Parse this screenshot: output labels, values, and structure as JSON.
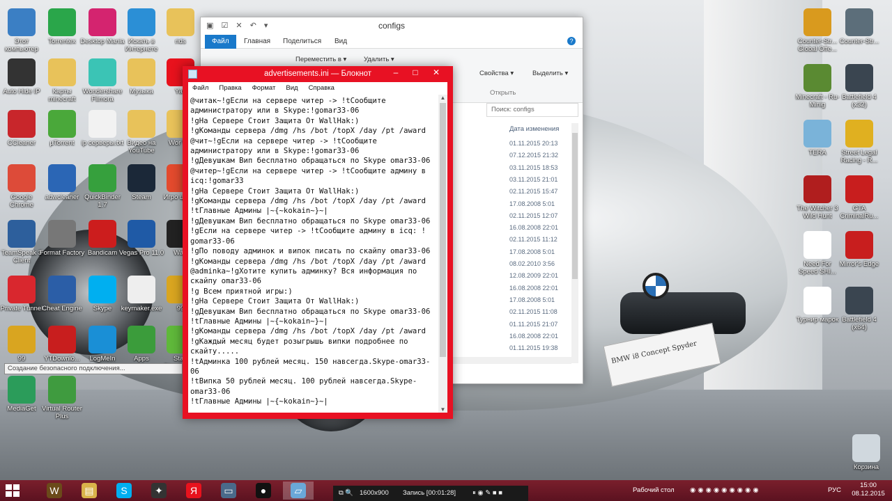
{
  "desktop": {
    "left_icons": [
      {
        "label": "Этот компьютер",
        "icon": "computer-icon",
        "color": "#3b7fc4"
      },
      {
        "label": "Torrentex",
        "icon": "torrentex-icon",
        "color": "#2aa64a"
      },
      {
        "label": "Desktop Mania",
        "icon": "desktop-mania-icon",
        "color": "#d4246f"
      },
      {
        "label": "Искать в Интернете",
        "icon": "search-web-icon",
        "color": "#2b8fd6"
      },
      {
        "label": "rids",
        "icon": "folder-icon",
        "color": "#e8c25a"
      },
      {
        "label": "Auto Hide IP",
        "icon": "auto-hide-ip-icon",
        "color": "#333333"
      },
      {
        "label": "Карты minecraft",
        "icon": "folder-icon",
        "color": "#e8c25a"
      },
      {
        "label": "Wondershare Filmora",
        "icon": "filmora-icon",
        "color": "#3bc4b5"
      },
      {
        "label": "Музыка",
        "icon": "folder-icon",
        "color": "#e8c25a"
      },
      {
        "label": "Yan",
        "icon": "yandex-icon",
        "color": "#e8121d"
      },
      {
        "label": "CCleaner",
        "icon": "ccleaner-icon",
        "color": "#c8262b"
      },
      {
        "label": "µTorrent",
        "icon": "utorrent-icon",
        "color": "#4aa83a"
      },
      {
        "label": "ip серверы.txt",
        "icon": "text-file-icon",
        "color": "#f2f2f2"
      },
      {
        "label": "Видео на YouTube",
        "icon": "folder-icon",
        "color": "#e8c25a"
      },
      {
        "label": "Wor Wo",
        "icon": "folder-icon",
        "color": "#e8c25a"
      },
      {
        "label": "Google Chrome",
        "icon": "chrome-icon",
        "color": "#dd4b39"
      },
      {
        "label": "adwcleaner",
        "icon": "adwcleaner-icon",
        "color": "#2b66b5"
      },
      {
        "label": "QuickBinder 1.7",
        "icon": "quickbinder-icon",
        "color": "#36a03d"
      },
      {
        "label": "Steam",
        "icon": "steam-icon",
        "color": "#1b2838"
      },
      {
        "label": "Игро центр",
        "icon": "game-center-icon",
        "color": "#e34a2d"
      },
      {
        "label": "TeamSpeak 3 Client",
        "icon": "teamspeak-icon",
        "color": "#2d5f9c"
      },
      {
        "label": "Format Factory",
        "icon": "format-factory-icon",
        "color": "#777777"
      },
      {
        "label": "Bandicam",
        "icon": "bandicam-icon",
        "color": "#cc1d1d"
      },
      {
        "label": "Vegas Pro 11.0",
        "icon": "vegas-icon",
        "color": "#1f5aa6"
      },
      {
        "label": "Warf",
        "icon": "warface-icon",
        "color": "#222222"
      },
      {
        "label": "Private Tunnel",
        "icon": "private-tunnel-icon",
        "color": "#d9272e"
      },
      {
        "label": "Cheat Engine",
        "icon": "cheat-engine-icon",
        "color": "#2b5ea7"
      },
      {
        "label": "Skype",
        "icon": "skype-icon",
        "color": "#00aff0"
      },
      {
        "label": "keymaker.exe",
        "icon": "keymaker-icon",
        "color": "#eeeeee"
      },
      {
        "label": "99",
        "icon": "counter-strike-icon",
        "color": "#d9a520"
      },
      {
        "label": "99",
        "icon": "counter-strike-icon",
        "color": "#d9a520"
      },
      {
        "label": "YTDownlo...",
        "icon": "ytdownloader-icon",
        "color": "#c81e1e"
      },
      {
        "label": "LogMeIn Hamachi",
        "icon": "hamachi-icon",
        "color": "#1a8fd6"
      },
      {
        "label": "Apps",
        "icon": "apps-icon",
        "color": "#3b9c3b"
      },
      {
        "label": "Start BlueStacks",
        "icon": "bluestacks-icon",
        "color": "#5fb83a"
      },
      {
        "label": "MediaGet",
        "icon": "mediaget-icon",
        "color": "#2b9c5a"
      },
      {
        "label": "Virtual Router Plus",
        "icon": "router-icon",
        "color": "#3f9b3f"
      }
    ],
    "right_icons": [
      {
        "label": "Counter-Str... Global Offe...",
        "icon": "csgo-icon",
        "color": "#d99a1e"
      },
      {
        "label": "Counter-Str...",
        "icon": "counter-strike-icon",
        "color": "#5c6e7a"
      },
      {
        "label": "Minecraft - Ru-Minig",
        "icon": "minecraft-icon",
        "color": "#5a8a32"
      },
      {
        "label": "Battlefield 4 (x32)",
        "icon": "battlefield-icon",
        "color": "#3a4550"
      },
      {
        "label": "TERA",
        "icon": "tera-icon",
        "color": "#7ab3d9"
      },
      {
        "label": "Street Legal Racing - R...",
        "icon": "car-icon",
        "color": "#e0b020"
      },
      {
        "label": "The Witcher 3 Wild Hunt",
        "icon": "witcher-icon",
        "color": "#b01e1e"
      },
      {
        "label": "GTA CriminalRu...",
        "icon": "gta-icon",
        "color": "#c81e1e"
      },
      {
        "label": "Need For Speed SHI...",
        "icon": "shortcut-icon",
        "color": "#ffffff"
      },
      {
        "label": "Mirror's Edge",
        "icon": "mirrors-edge-icon",
        "color": "#c81e1e"
      },
      {
        "label": "Турнир марок",
        "icon": "shortcut-icon",
        "color": "#ffffff"
      },
      {
        "label": "Battlefield 4 (x64)",
        "icon": "battlefield-icon",
        "color": "#3a4550"
      },
      {
        "label": "Корзина",
        "icon": "recycle-bin-icon",
        "color": "#d0d8de"
      }
    ],
    "tooltip": "Создание безопасного подключения..."
  },
  "explorer": {
    "title": "configs",
    "tabs": [
      "Файл",
      "Главная",
      "Поделиться",
      "Вид"
    ],
    "ribbon": {
      "move_to": "Переместить в ▾",
      "delete": "Удалить ▾",
      "properties": "Свойства ▾",
      "open_group": "Открыть",
      "select": "Выделить ▾"
    },
    "search_placeholder": "Поиск: configs",
    "column_date": "Дата изменения",
    "dates": [
      "01.11.2015 20:13",
      "07.12.2015 21:32",
      "03.11.2015 18:53",
      "03.11.2015 21:01",
      "02.11.2015 15:47",
      "17.08.2008 5:01",
      "02.11.2015 12:07",
      "16.08.2008 22:01",
      "02.11.2015 11:12",
      "17.08.2008 5:01",
      "08.02.2010 3:56",
      "12.08.2009 22:01",
      "16.08.2008 22:01",
      "17.08.2008 5:01",
      "02.11.2015 11:08",
      "01.11.2015 21:07",
      "16.08.2008 22:01",
      "01.11.2015 19:38",
      "04.11.2015 18:32"
    ]
  },
  "notepad": {
    "title": "advertisements.ini — Блокнот",
    "menu": [
      "Файл",
      "Правка",
      "Формат",
      "Вид",
      "Справка"
    ],
    "content": "@читак~!gЕсли на сервере читер -> !tСообщите администратору или в Skype:!gomar33-06\n!gНа Сервере Стоит Защита От WallHak:)\n!gКоманды сервера /dmg /hs /bot /topX /day /pt /award\n@чит~!gЕсли на сервере читер -> !tСообщите администратору или в Skype:!gomar33-06\n!gДевушкам Вип бесплатно обращаться по Skype omar33-06\n@читер~!gЕсли на сервере читер -> !tСообщите админу в icq:!gomar33\n!gНа Сервере Стоит Защита От WallHak:)\n!gКоманды сервера /dmg /hs /bot /topX /day /pt /award\n!tГлавные Админы |~{~kokain~}~|\n!gДевушкам Вип бесплатно обращаться по Skype omar33-06\n!gЕсли на сервере читер -> !tСообщите админу в icq: ! gomar33-06\n!gПо поводу админок и випок писать по скайпу omar33-06\n!gКоманды сервера /dmg /hs /bot /topX /day /pt /award\n@adminka~!gХотите купить админку? Вся информация по скайпу omar33-06\n!g Всем приятной игры:)\n!gНа Сервере Стоит Защита От WallHak:)\n!gДевушкам Вип бесплатно обращаться по Skype omar33-06\n!tГлавные Админы |~{~kokain~}~|\n!gКоманды сервера /dmg /hs /bot /topX /day /pt /award\n!gКаждый месяц будет розыгрышь випки подробнее по скайту.....\n!tАдминка 100 рублей месяц. 150 навсегда.Skype-omar33-06\n!tВипка 50 рублей месяц. 100 рублей навсегда.Skype-omar33-06\n!tГлавные Админы |~{~kokain~}~|"
  },
  "taskbar": {
    "apps": [
      "wow-icon",
      "explorer-icon",
      "skype-icon",
      "counter-strike-icon",
      "yandex-icon",
      "computer-icon",
      "bandicam-icon",
      "notepad-icon"
    ],
    "recorder": {
      "resolution": "1600x900",
      "recording": "Запись [00:01:28]"
    },
    "desktop_label": "Рабочий стол",
    "language": "РУС",
    "time": "15:00",
    "date": "08.12.2015"
  }
}
